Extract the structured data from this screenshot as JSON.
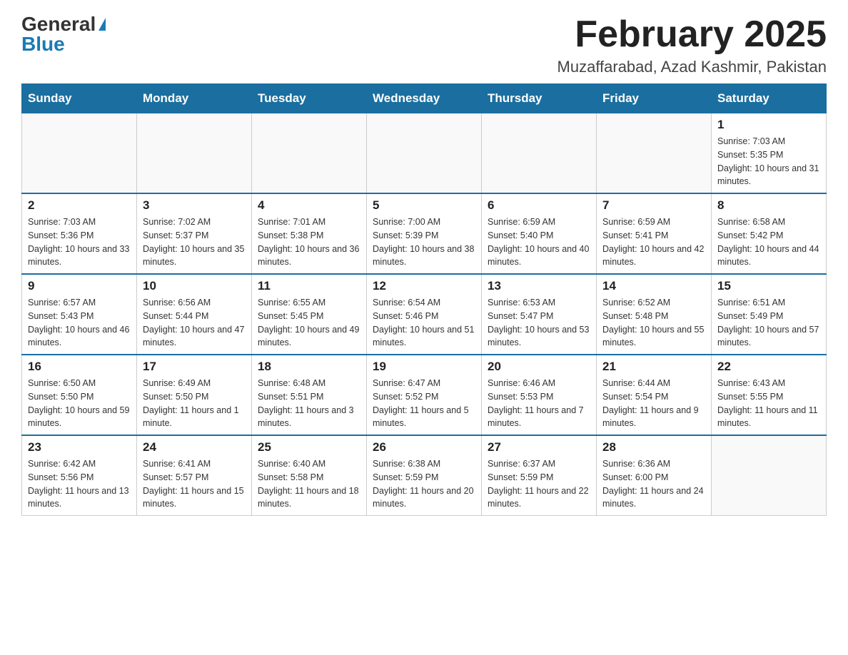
{
  "header": {
    "logo_general": "General",
    "logo_blue": "Blue",
    "month_title": "February 2025",
    "location": "Muzaffarabad, Azad Kashmir, Pakistan"
  },
  "days_of_week": [
    "Sunday",
    "Monday",
    "Tuesday",
    "Wednesday",
    "Thursday",
    "Friday",
    "Saturday"
  ],
  "weeks": [
    [
      {
        "day": "",
        "info": ""
      },
      {
        "day": "",
        "info": ""
      },
      {
        "day": "",
        "info": ""
      },
      {
        "day": "",
        "info": ""
      },
      {
        "day": "",
        "info": ""
      },
      {
        "day": "",
        "info": ""
      },
      {
        "day": "1",
        "info": "Sunrise: 7:03 AM\nSunset: 5:35 PM\nDaylight: 10 hours and 31 minutes."
      }
    ],
    [
      {
        "day": "2",
        "info": "Sunrise: 7:03 AM\nSunset: 5:36 PM\nDaylight: 10 hours and 33 minutes."
      },
      {
        "day": "3",
        "info": "Sunrise: 7:02 AM\nSunset: 5:37 PM\nDaylight: 10 hours and 35 minutes."
      },
      {
        "day": "4",
        "info": "Sunrise: 7:01 AM\nSunset: 5:38 PM\nDaylight: 10 hours and 36 minutes."
      },
      {
        "day": "5",
        "info": "Sunrise: 7:00 AM\nSunset: 5:39 PM\nDaylight: 10 hours and 38 minutes."
      },
      {
        "day": "6",
        "info": "Sunrise: 6:59 AM\nSunset: 5:40 PM\nDaylight: 10 hours and 40 minutes."
      },
      {
        "day": "7",
        "info": "Sunrise: 6:59 AM\nSunset: 5:41 PM\nDaylight: 10 hours and 42 minutes."
      },
      {
        "day": "8",
        "info": "Sunrise: 6:58 AM\nSunset: 5:42 PM\nDaylight: 10 hours and 44 minutes."
      }
    ],
    [
      {
        "day": "9",
        "info": "Sunrise: 6:57 AM\nSunset: 5:43 PM\nDaylight: 10 hours and 46 minutes."
      },
      {
        "day": "10",
        "info": "Sunrise: 6:56 AM\nSunset: 5:44 PM\nDaylight: 10 hours and 47 minutes."
      },
      {
        "day": "11",
        "info": "Sunrise: 6:55 AM\nSunset: 5:45 PM\nDaylight: 10 hours and 49 minutes."
      },
      {
        "day": "12",
        "info": "Sunrise: 6:54 AM\nSunset: 5:46 PM\nDaylight: 10 hours and 51 minutes."
      },
      {
        "day": "13",
        "info": "Sunrise: 6:53 AM\nSunset: 5:47 PM\nDaylight: 10 hours and 53 minutes."
      },
      {
        "day": "14",
        "info": "Sunrise: 6:52 AM\nSunset: 5:48 PM\nDaylight: 10 hours and 55 minutes."
      },
      {
        "day": "15",
        "info": "Sunrise: 6:51 AM\nSunset: 5:49 PM\nDaylight: 10 hours and 57 minutes."
      }
    ],
    [
      {
        "day": "16",
        "info": "Sunrise: 6:50 AM\nSunset: 5:50 PM\nDaylight: 10 hours and 59 minutes."
      },
      {
        "day": "17",
        "info": "Sunrise: 6:49 AM\nSunset: 5:50 PM\nDaylight: 11 hours and 1 minute."
      },
      {
        "day": "18",
        "info": "Sunrise: 6:48 AM\nSunset: 5:51 PM\nDaylight: 11 hours and 3 minutes."
      },
      {
        "day": "19",
        "info": "Sunrise: 6:47 AM\nSunset: 5:52 PM\nDaylight: 11 hours and 5 minutes."
      },
      {
        "day": "20",
        "info": "Sunrise: 6:46 AM\nSunset: 5:53 PM\nDaylight: 11 hours and 7 minutes."
      },
      {
        "day": "21",
        "info": "Sunrise: 6:44 AM\nSunset: 5:54 PM\nDaylight: 11 hours and 9 minutes."
      },
      {
        "day": "22",
        "info": "Sunrise: 6:43 AM\nSunset: 5:55 PM\nDaylight: 11 hours and 11 minutes."
      }
    ],
    [
      {
        "day": "23",
        "info": "Sunrise: 6:42 AM\nSunset: 5:56 PM\nDaylight: 11 hours and 13 minutes."
      },
      {
        "day": "24",
        "info": "Sunrise: 6:41 AM\nSunset: 5:57 PM\nDaylight: 11 hours and 15 minutes."
      },
      {
        "day": "25",
        "info": "Sunrise: 6:40 AM\nSunset: 5:58 PM\nDaylight: 11 hours and 18 minutes."
      },
      {
        "day": "26",
        "info": "Sunrise: 6:38 AM\nSunset: 5:59 PM\nDaylight: 11 hours and 20 minutes."
      },
      {
        "day": "27",
        "info": "Sunrise: 6:37 AM\nSunset: 5:59 PM\nDaylight: 11 hours and 22 minutes."
      },
      {
        "day": "28",
        "info": "Sunrise: 6:36 AM\nSunset: 6:00 PM\nDaylight: 11 hours and 24 minutes."
      },
      {
        "day": "",
        "info": ""
      }
    ]
  ]
}
